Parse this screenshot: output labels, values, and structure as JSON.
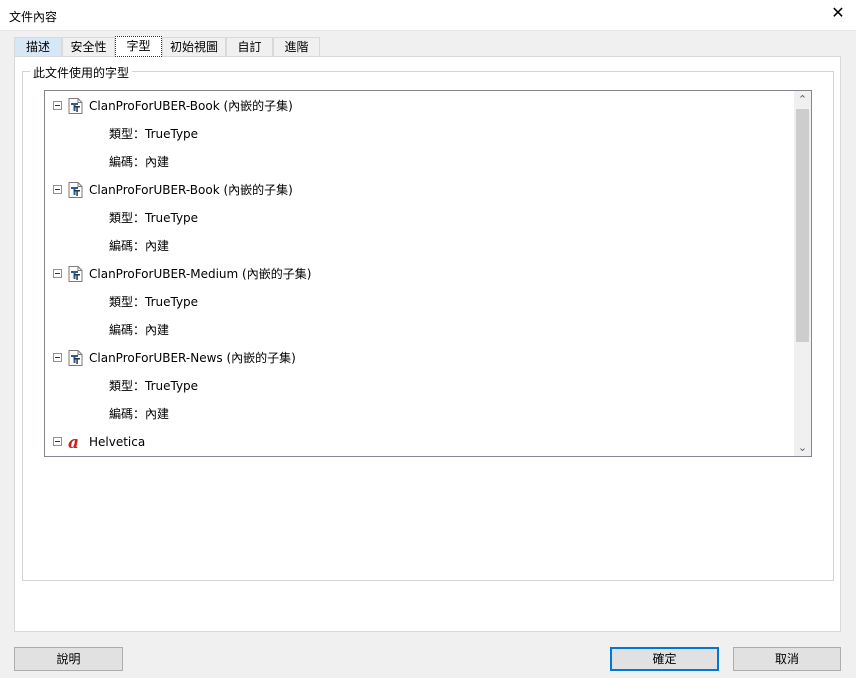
{
  "window": {
    "title": "文件內容",
    "close_glyph": "✕"
  },
  "tabs": [
    {
      "label": "描述"
    },
    {
      "label": "安全性"
    },
    {
      "label": "字型"
    },
    {
      "label": "初始視圖"
    },
    {
      "label": "自訂"
    },
    {
      "label": "進階"
    }
  ],
  "group": {
    "legend": "此文件使用的字型"
  },
  "fonts": [
    {
      "name": "ClanProForUBER-Book (內嵌的子集)",
      "type": "類型：TrueType",
      "encoding": "編碼：內建",
      "icon": "truetype-font-icon"
    },
    {
      "name": "ClanProForUBER-Book (內嵌的子集)",
      "type": "類型：TrueType",
      "encoding": "編碼：內建",
      "icon": "truetype-font-icon"
    },
    {
      "name": "ClanProForUBER-Medium (內嵌的子集)",
      "type": "類型：TrueType",
      "encoding": "編碼：內建",
      "icon": "truetype-font-icon"
    },
    {
      "name": "ClanProForUBER-News (內嵌的子集)",
      "type": "類型：TrueType",
      "encoding": "編碼：內建",
      "icon": "truetype-font-icon"
    },
    {
      "name": "Helvetica",
      "icon": "type1-font-icon"
    }
  ],
  "scrollbar": {
    "up": "⌃",
    "down": "⌄"
  },
  "buttons": {
    "help": "說明",
    "ok": "確定",
    "cancel": "取消"
  }
}
